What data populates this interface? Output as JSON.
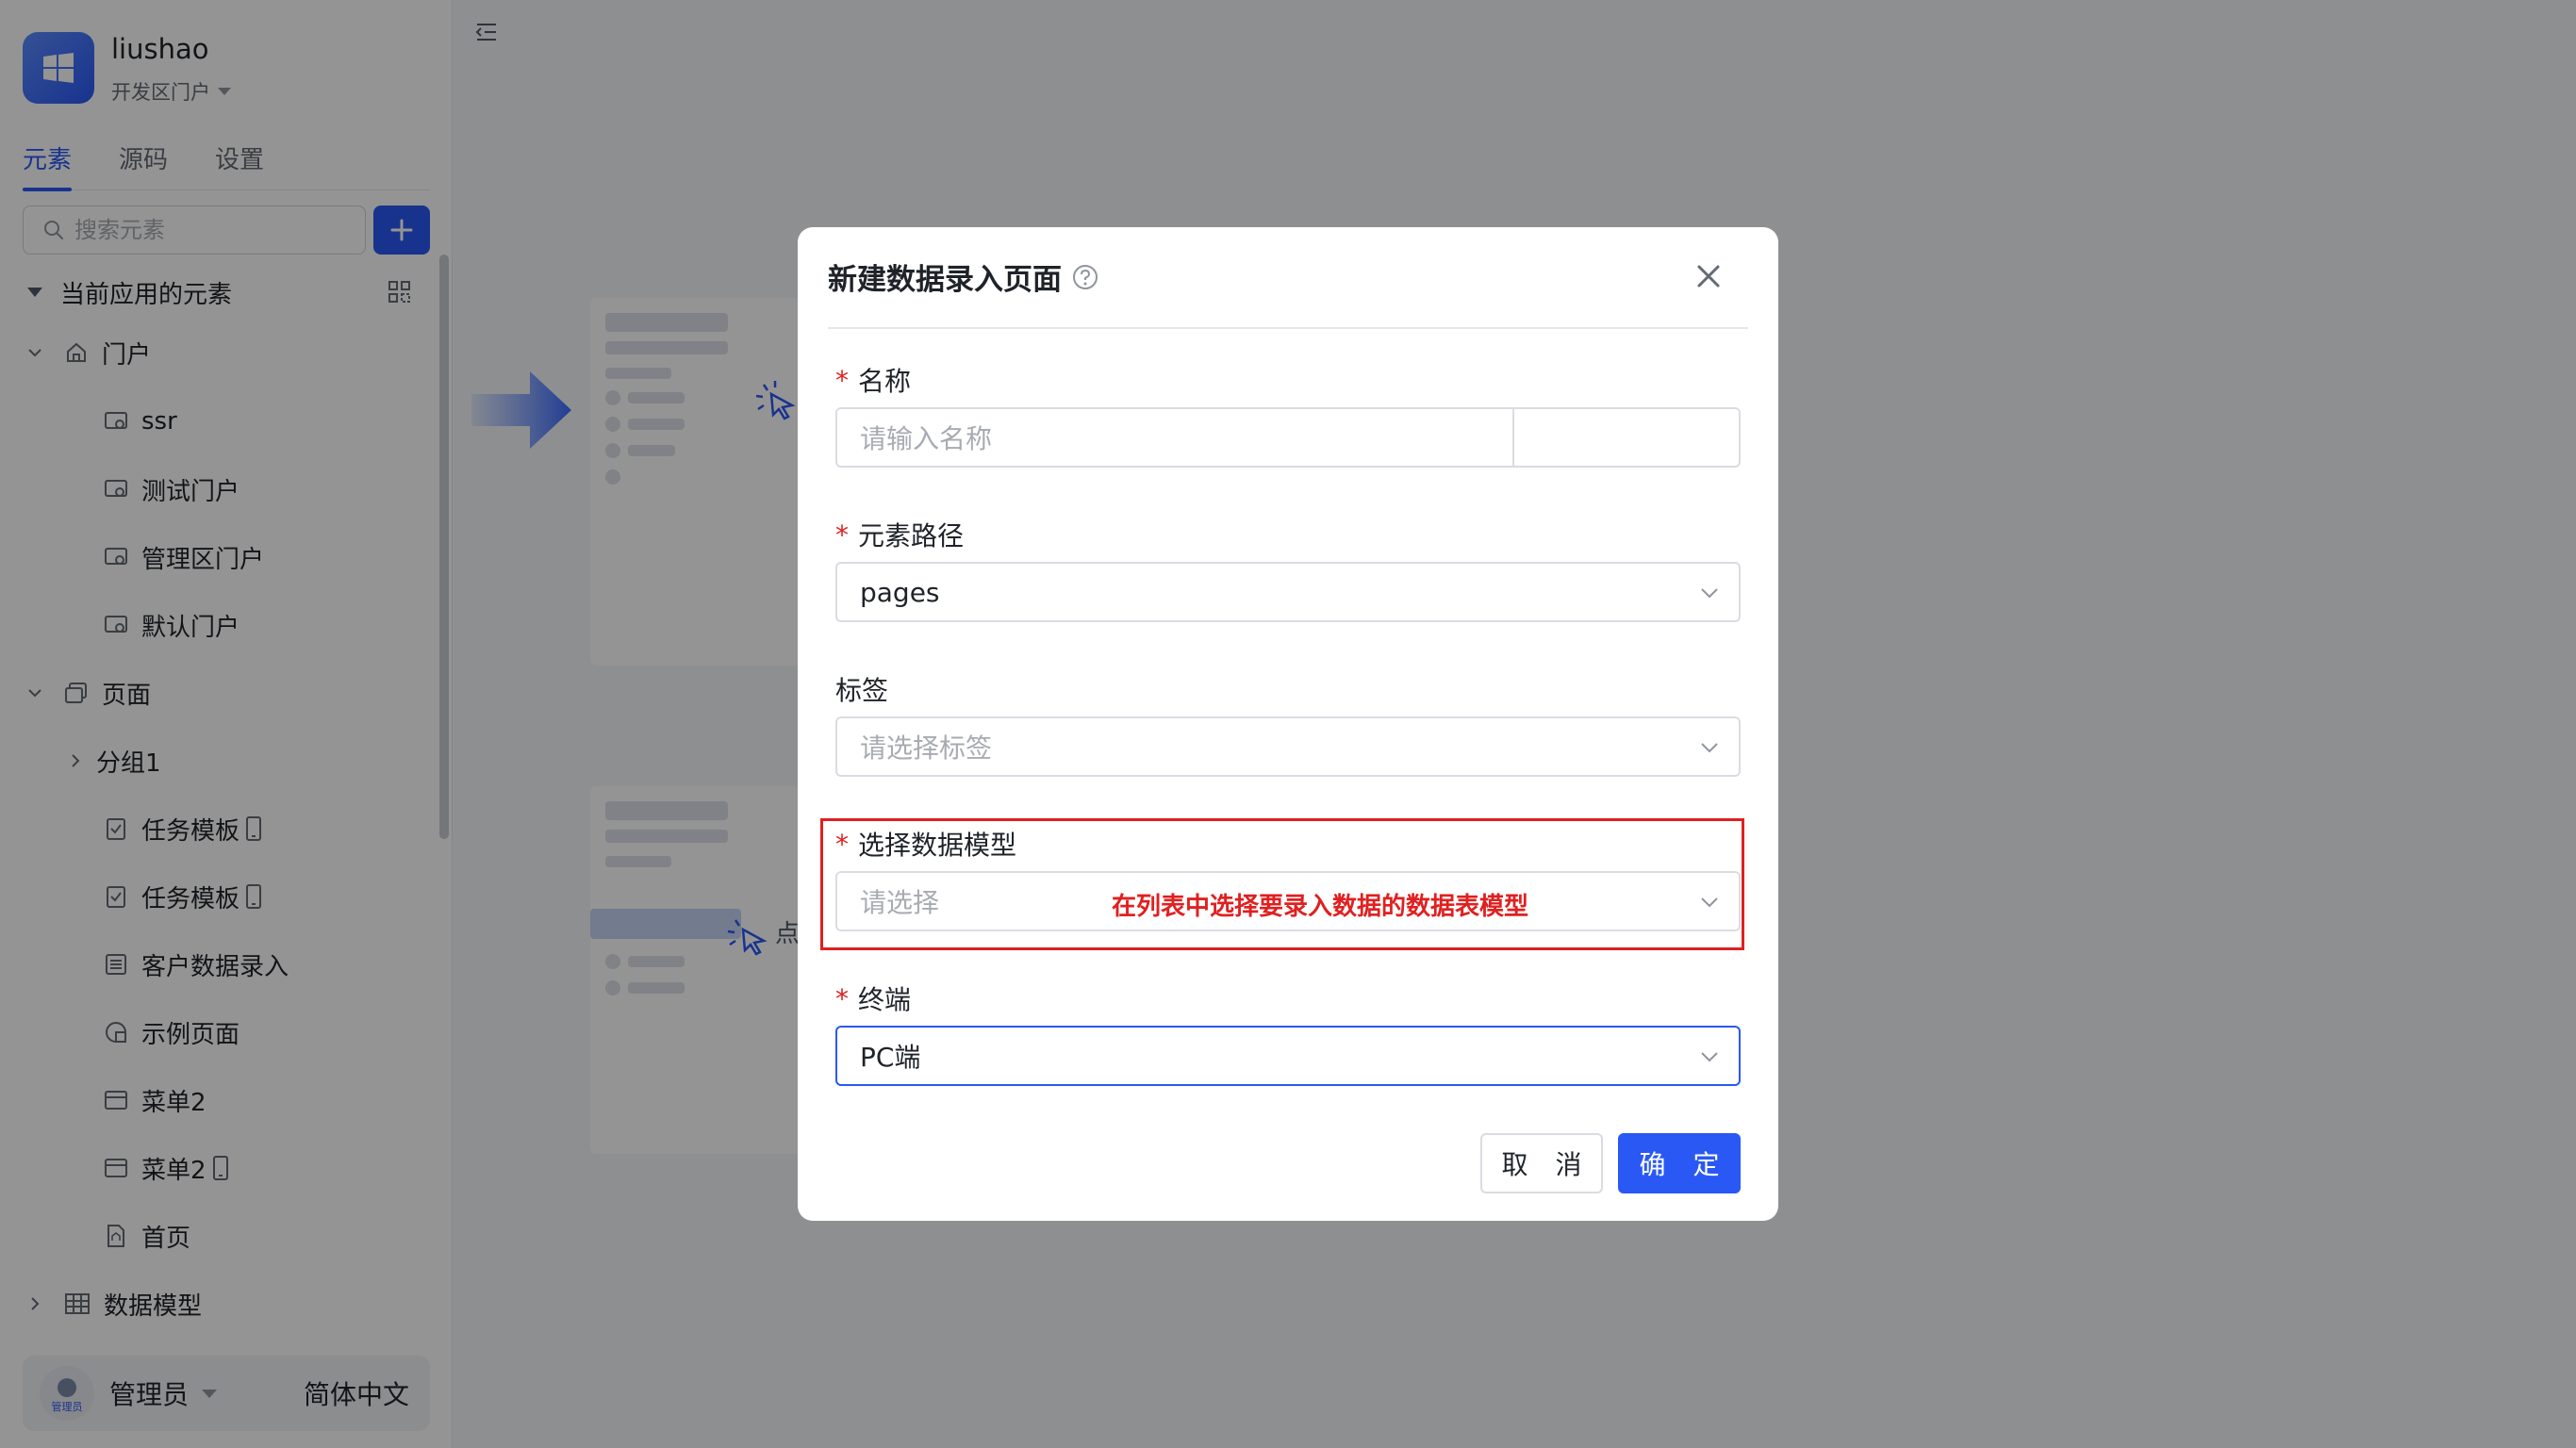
{
  "app": {
    "name": "liushao",
    "portal": "开发区门户"
  },
  "tabs": [
    {
      "label": "元素"
    },
    {
      "label": "源码"
    },
    {
      "label": "设置"
    }
  ],
  "search": {
    "placeholder": "搜索元素"
  },
  "tree": {
    "section_title": "当前应用的元素",
    "portal_group": "门户",
    "portals": [
      "ssr",
      "测试门户",
      "管理区门户",
      "默认门户"
    ],
    "pages_group": "页面",
    "subgroup": "分组1",
    "pages": [
      "任务模板",
      "任务模板",
      "客户数据录入",
      "示例页面",
      "菜单2",
      "菜单2",
      "首页"
    ],
    "data_model_group": "数据模型"
  },
  "user": {
    "name": "管理员",
    "avatar_tag": "管理员",
    "language": "简体中文"
  },
  "canvas": {
    "hint_fragment": "点"
  },
  "dialog": {
    "title": "新建数据录入页面",
    "fields": {
      "name": {
        "label": "名称",
        "placeholder": "请输入名称"
      },
      "path": {
        "label": "元素路径",
        "value": "pages"
      },
      "tags": {
        "label": "标签",
        "placeholder": "请选择标签"
      },
      "model": {
        "label": "选择数据模型",
        "placeholder": "请选择",
        "annotation": "在列表中选择要录入数据的数据表模型"
      },
      "terminal": {
        "label": "终端",
        "value": "PC端"
      }
    },
    "cancel_label": "取 消",
    "ok_label": "确 定"
  },
  "colors": {
    "primary": "#2a58f5",
    "annotation_red": "#e02020"
  }
}
